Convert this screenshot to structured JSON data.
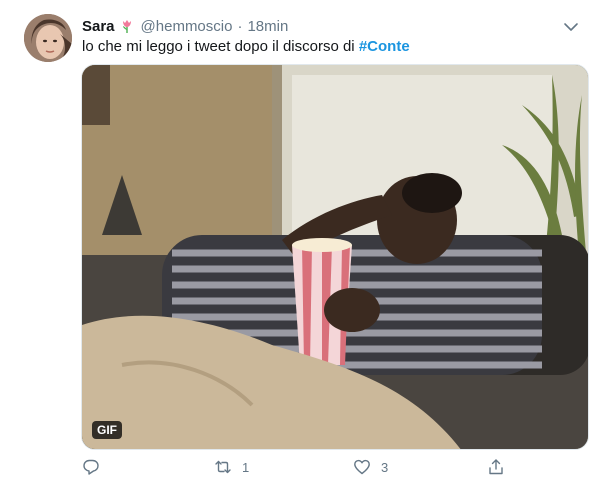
{
  "tweet": {
    "author_name": "Sara",
    "author_handle": "@hemmoscio",
    "separator": "·",
    "time": "18min",
    "text_prefix": "lo che mi leggo i tweet dopo il discorso di",
    "hashtag": "#Conte",
    "media_badge": "GIF"
  },
  "actions": {
    "reply_icon": "reply-icon",
    "retweet_icon": "retweet-icon",
    "retweet_count": "1",
    "like_icon": "heart-icon",
    "like_count": "3",
    "share_icon": "share-icon"
  },
  "colors": {
    "text": "#14171a",
    "secondary": "#657786",
    "link": "#1b95e0"
  }
}
